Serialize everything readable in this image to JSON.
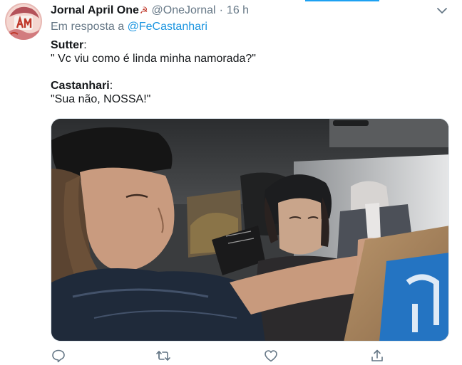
{
  "tweet": {
    "author_name": "Jornal April One",
    "name_emoji": "☭",
    "handle": "@OneJornal",
    "separator": "·",
    "time": "16 h",
    "reply_prefix": "Em resposta a ",
    "reply_handle": "@FeCastanhari",
    "lines": [
      {
        "speaker": "Sutter",
        "colon": ":",
        "quote": "\" Vc viu como é linda minha namorada?\""
      },
      {
        "speaker": "Castanhari",
        "colon": ":",
        "quote": "\"Sua não, NOSSA!\""
      }
    ]
  },
  "icons": {
    "menu": "chevron-down-icon",
    "reply": "comment-icon",
    "retweet": "retweet-icon",
    "like": "heart-icon",
    "share": "share-icon"
  },
  "colors": {
    "accent": "#1da1f2",
    "link": "#1b95e0",
    "secondary_text": "#657786",
    "icon": "#657786"
  }
}
